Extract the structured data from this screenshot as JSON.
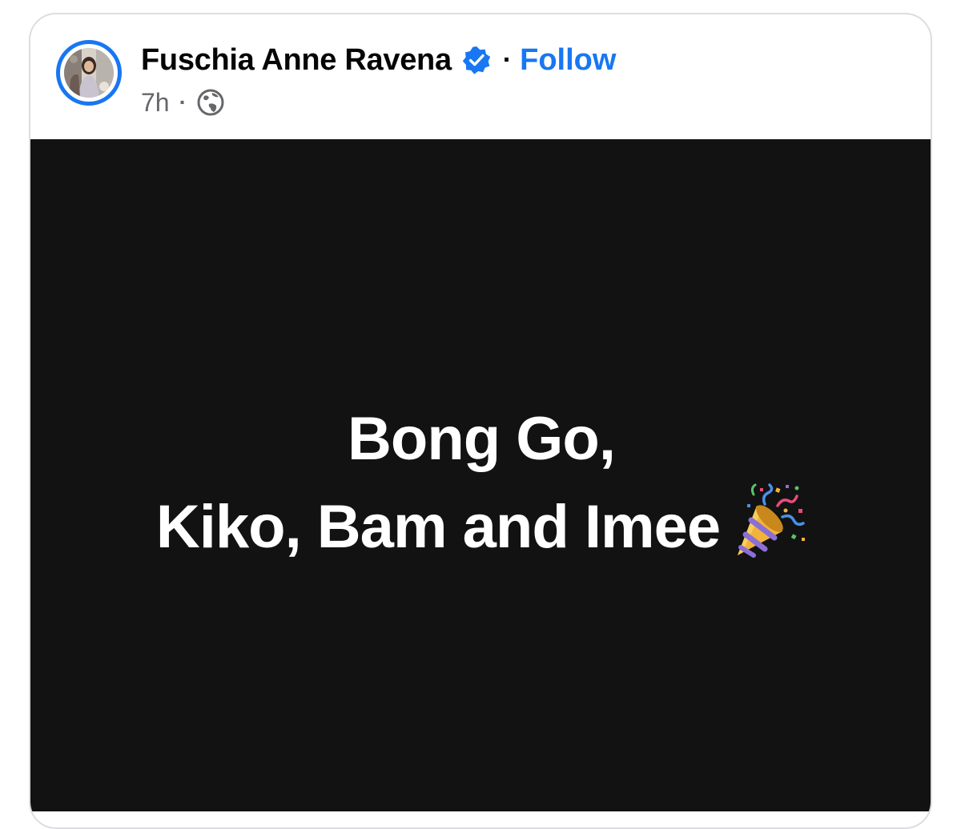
{
  "post": {
    "author": {
      "name": "Fuschia Anne Ravena",
      "verified_icon": "verified-badge-icon",
      "follow_label": "Follow",
      "separator": "·"
    },
    "meta": {
      "timestamp": "7h",
      "separator": "·",
      "audience_icon": "globe-icon"
    },
    "content": {
      "line1": "Bong Go,",
      "line2": "Kiko, Bam and Imee",
      "emoji_icon": "party-popper-icon",
      "background_color": "#121212",
      "text_color": "#ffffff"
    }
  },
  "colors": {
    "accent": "#1877f2",
    "secondary_text": "#65676b",
    "card_border": "#dcdde0"
  }
}
